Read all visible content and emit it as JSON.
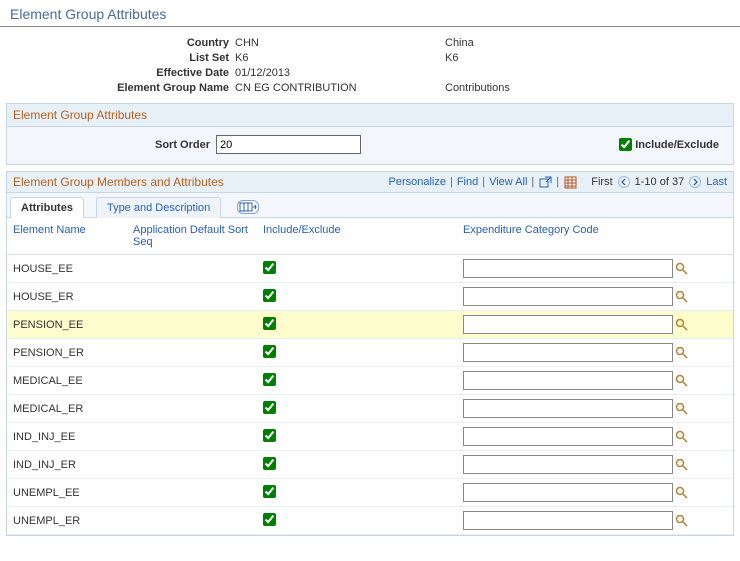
{
  "page_title": "Element Group Attributes",
  "header": {
    "country_label": "Country",
    "country_code": "CHN",
    "country_desc": "China",
    "listset_label": "List Set",
    "listset_code": "K6",
    "listset_desc": "K6",
    "effdate_label": "Effective Date",
    "effdate_value": "01/12/2013",
    "eg_name_label": "Element Group Name",
    "eg_name_value": "CN EG CONTRIBUTION",
    "eg_name_desc": "Contributions"
  },
  "groupbox": {
    "title": "Element Group Attributes",
    "sort_order_label": "Sort Order",
    "sort_order_value": "20",
    "include_exclude_label": "Include/Exclude",
    "include_exclude_checked": true
  },
  "grid": {
    "title": "Element Group Members and Attributes",
    "actions": {
      "personalize": "Personalize",
      "find": "Find",
      "view_all": "View All",
      "first": "First",
      "range": "1-10 of 37",
      "last": "Last"
    },
    "tabs": {
      "attributes": "Attributes",
      "type_desc": "Type and Description"
    },
    "columns": {
      "element_name": "Element Name",
      "app_default_sort": "Application Default Sort Seq",
      "include_exclude": "Include/Exclude",
      "exp_cat_code": "Expenditure Category Code"
    },
    "rows": [
      {
        "element_name": "HOUSE_EE",
        "sort_seq": "",
        "include": true,
        "exp_cat": "",
        "highlight": false
      },
      {
        "element_name": "HOUSE_ER",
        "sort_seq": "",
        "include": true,
        "exp_cat": "",
        "highlight": false
      },
      {
        "element_name": "PENSION_EE",
        "sort_seq": "",
        "include": true,
        "exp_cat": "",
        "highlight": true
      },
      {
        "element_name": "PENSION_ER",
        "sort_seq": "",
        "include": true,
        "exp_cat": "",
        "highlight": false
      },
      {
        "element_name": "MEDICAL_EE",
        "sort_seq": "",
        "include": true,
        "exp_cat": "",
        "highlight": false
      },
      {
        "element_name": "MEDICAL_ER",
        "sort_seq": "",
        "include": true,
        "exp_cat": "",
        "highlight": false
      },
      {
        "element_name": "IND_INJ_EE",
        "sort_seq": "",
        "include": true,
        "exp_cat": "",
        "highlight": false
      },
      {
        "element_name": "IND_INJ_ER",
        "sort_seq": "",
        "include": true,
        "exp_cat": "",
        "highlight": false
      },
      {
        "element_name": "UNEMPL_EE",
        "sort_seq": "",
        "include": true,
        "exp_cat": "",
        "highlight": false
      },
      {
        "element_name": "UNEMPL_ER",
        "sort_seq": "",
        "include": true,
        "exp_cat": "",
        "highlight": false
      }
    ]
  }
}
